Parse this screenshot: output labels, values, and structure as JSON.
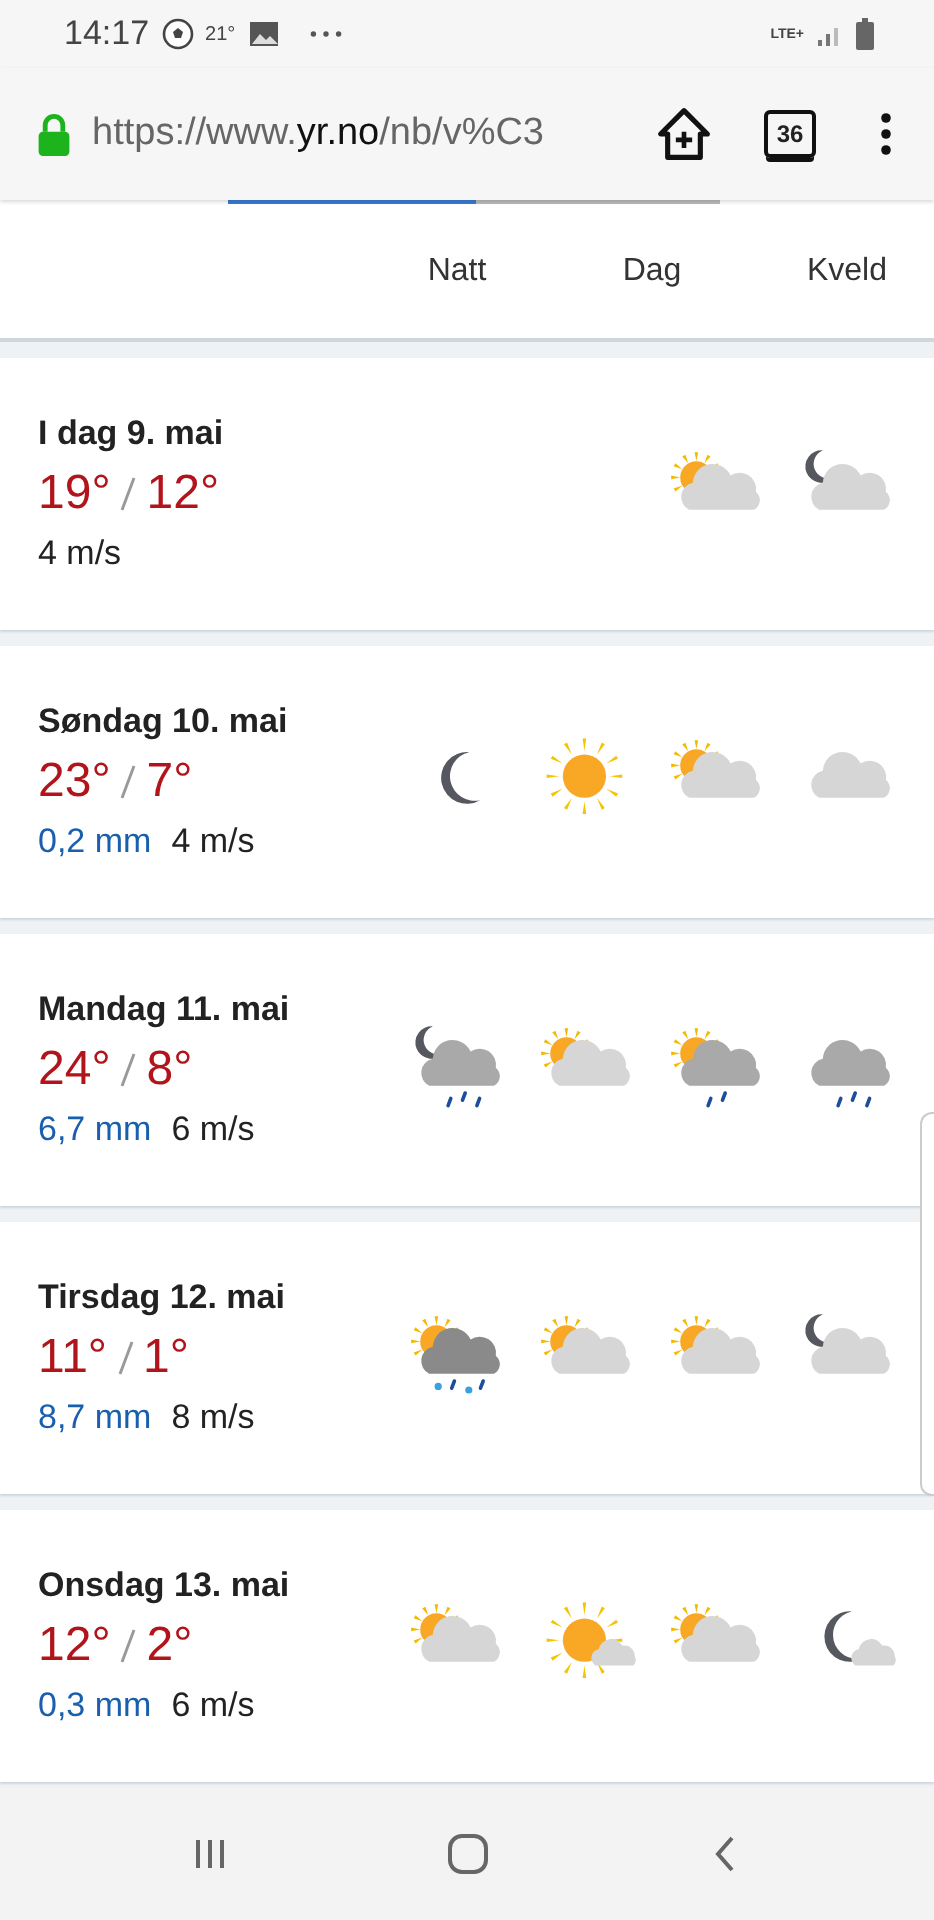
{
  "status_bar": {
    "time": "14:17",
    "temperature": "21°",
    "network": "LTE+"
  },
  "browser": {
    "url_prefix": "https://www.",
    "url_domain": "yr.no",
    "url_path": "/nb/v%C3",
    "tab_count": "36"
  },
  "columns": [
    "Natt",
    "Dag",
    "Kveld"
  ],
  "days": [
    {
      "title": "I dag 9. mai",
      "high": "19°",
      "low": "12°",
      "wind": "4 m/s",
      "periods": [
        {
          "kind": "none"
        },
        {
          "kind": "none"
        },
        {
          "kind": "partly-cloudy"
        },
        {
          "kind": "moon-cloud"
        }
      ]
    },
    {
      "title": "Søndag 10. mai",
      "high": "23°",
      "low": "7°",
      "precipitation": "0,2 mm",
      "wind": "4 m/s",
      "periods": [
        {
          "kind": "moon"
        },
        {
          "kind": "sun"
        },
        {
          "kind": "partly-cloudy"
        },
        {
          "kind": "cloud"
        }
      ]
    },
    {
      "title": "Mandag 11. mai",
      "high": "24°",
      "low": "8°",
      "precipitation": "6,7 mm",
      "wind": "6 m/s",
      "periods": [
        {
          "kind": "moon-rain"
        },
        {
          "kind": "partly-cloudy"
        },
        {
          "kind": "partly-cloudy-rain"
        },
        {
          "kind": "rain"
        }
      ]
    },
    {
      "title": "Tirsdag 12. mai",
      "high": "11°",
      "low": "1°",
      "precipitation": "8,7 mm",
      "wind": "8 m/s",
      "periods": [
        {
          "kind": "sun-sleet"
        },
        {
          "kind": "partly-cloudy"
        },
        {
          "kind": "partly-cloudy"
        },
        {
          "kind": "moon-cloud"
        }
      ]
    },
    {
      "title": "Onsdag 13. mai",
      "high": "12°",
      "low": "2°",
      "precipitation": "0,3 mm",
      "wind": "6 m/s",
      "periods": [
        {
          "kind": "partly-cloudy"
        },
        {
          "kind": "fair"
        },
        {
          "kind": "partly-cloudy"
        },
        {
          "kind": "moon-small-cloud"
        }
      ]
    }
  ]
}
